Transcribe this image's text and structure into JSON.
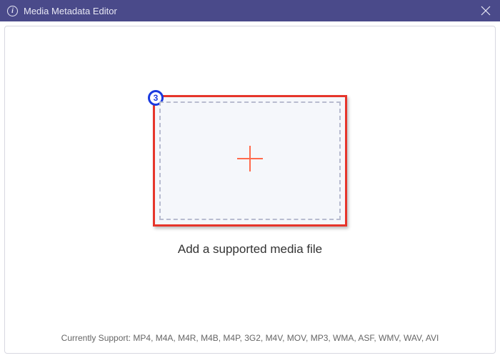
{
  "titlebar": {
    "title": "Media Metadata Editor"
  },
  "dropzone": {
    "badge": "3",
    "instruction": "Add a supported media file"
  },
  "footer": {
    "label": "Currently Support: ",
    "formats": "MP4, M4A, M4R, M4B, M4P, 3G2, M4V, MOV, MP3, WMA, ASF, WMV, WAV, AVI"
  }
}
